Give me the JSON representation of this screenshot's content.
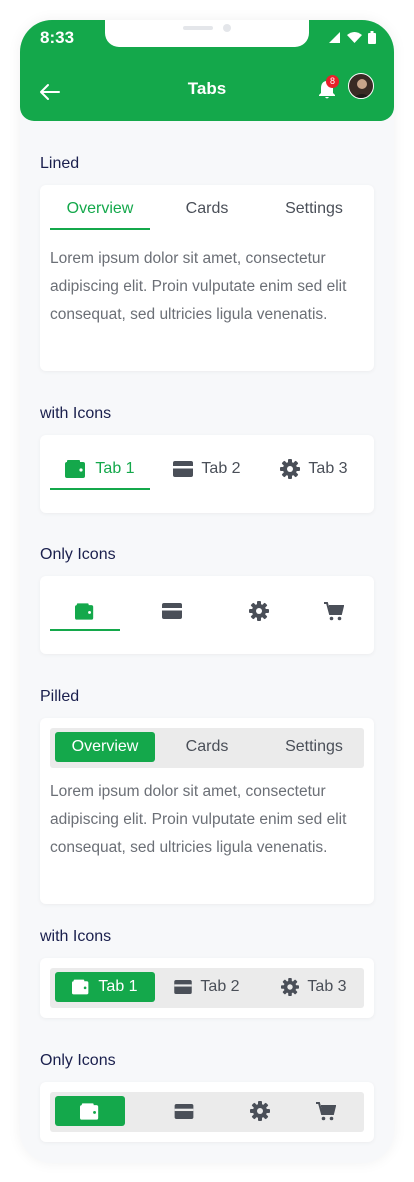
{
  "status_bar": {
    "time": "8:33"
  },
  "header": {
    "title": "Tabs",
    "notification_count": "8"
  },
  "colors": {
    "accent": "#14a84b",
    "badge": "#e8202a",
    "text_dark": "#1a1f4d",
    "text_gray": "#6b6f76"
  },
  "lined": {
    "label": "Lined",
    "tabs": [
      "Overview",
      "Cards",
      "Settings"
    ],
    "content": "Lorem ipsum dolor sit amet, consectetur adipiscing elit. Proin vulputate enim sed elit consequat, sed ultricies ligula venenatis."
  },
  "lined_icons": {
    "label": "with Icons",
    "tabs": [
      {
        "icon": "wallet-icon",
        "label": "Tab 1"
      },
      {
        "icon": "card-icon",
        "label": "Tab 2"
      },
      {
        "icon": "gear-icon",
        "label": "Tab 3"
      }
    ]
  },
  "lined_only_icons": {
    "label": "Only Icons",
    "icons": [
      "wallet-icon",
      "card-icon",
      "gear-icon",
      "cart-icon"
    ]
  },
  "pilled": {
    "label": "Pilled",
    "tabs": [
      "Overview",
      "Cards",
      "Settings"
    ],
    "content": "Lorem ipsum dolor sit amet, consectetur adipiscing elit. Proin vulputate enim sed elit consequat, sed ultricies ligula venenatis."
  },
  "pilled_icons": {
    "label": "with Icons",
    "tabs": [
      {
        "icon": "wallet-icon",
        "label": "Tab 1"
      },
      {
        "icon": "card-icon",
        "label": "Tab 2"
      },
      {
        "icon": "gear-icon",
        "label": "Tab 3"
      }
    ]
  },
  "pilled_only_icons": {
    "label": "Only Icons",
    "icons": [
      "wallet-icon",
      "card-icon",
      "gear-icon",
      "cart-icon"
    ]
  }
}
